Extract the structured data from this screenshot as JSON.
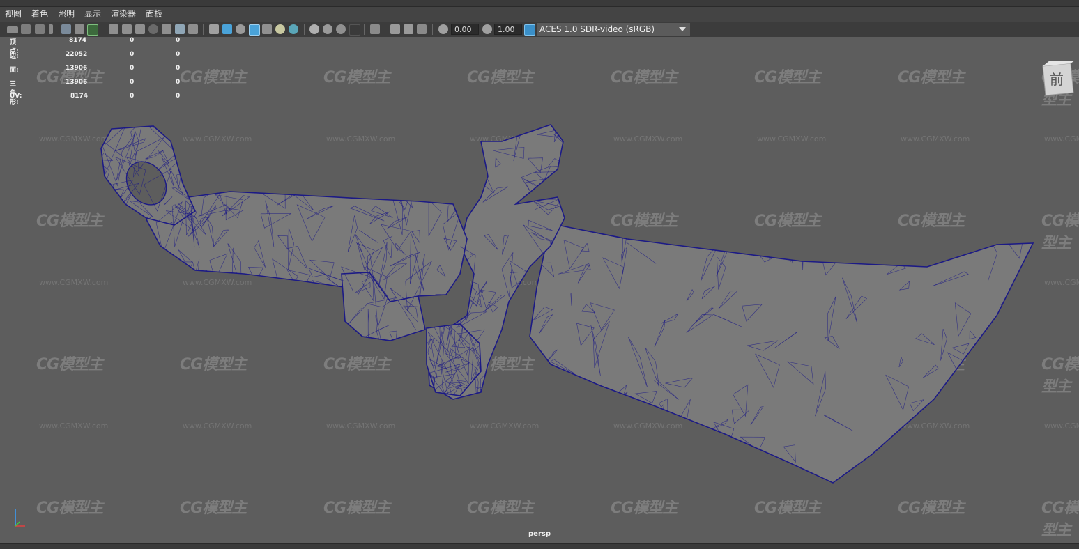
{
  "menu": [
    "视图",
    "着色",
    "照明",
    "显示",
    "渲染器",
    "面板"
  ],
  "toolbar": {
    "field_a": "0.00",
    "field_b": "1.00",
    "colorspace": "ACES 1.0 SDR-video (sRGB)"
  },
  "hud": [
    {
      "label": "顶点:",
      "v1": "8174",
      "v2": "0",
      "v3": "0"
    },
    {
      "label": "边:",
      "v1": "22052",
      "v2": "0",
      "v3": "0"
    },
    {
      "label": "面:",
      "v1": "13906",
      "v2": "0",
      "v3": "0"
    },
    {
      "label": "三角形:",
      "v1": "13906",
      "v2": "0",
      "v3": "0"
    },
    {
      "label": "UV:",
      "v1": "8174",
      "v2": "0",
      "v3": "0"
    }
  ],
  "viewcube_label": "前",
  "camera": "persp",
  "watermark": {
    "logo": "CG模型主",
    "url": "www.CGMXW.com"
  },
  "colors": {
    "wire": "#1c1a86",
    "mesh_fill": "#7a7a7a",
    "viewport_bg": "#5d5d5d",
    "accent_active": "#4aa3d9"
  }
}
